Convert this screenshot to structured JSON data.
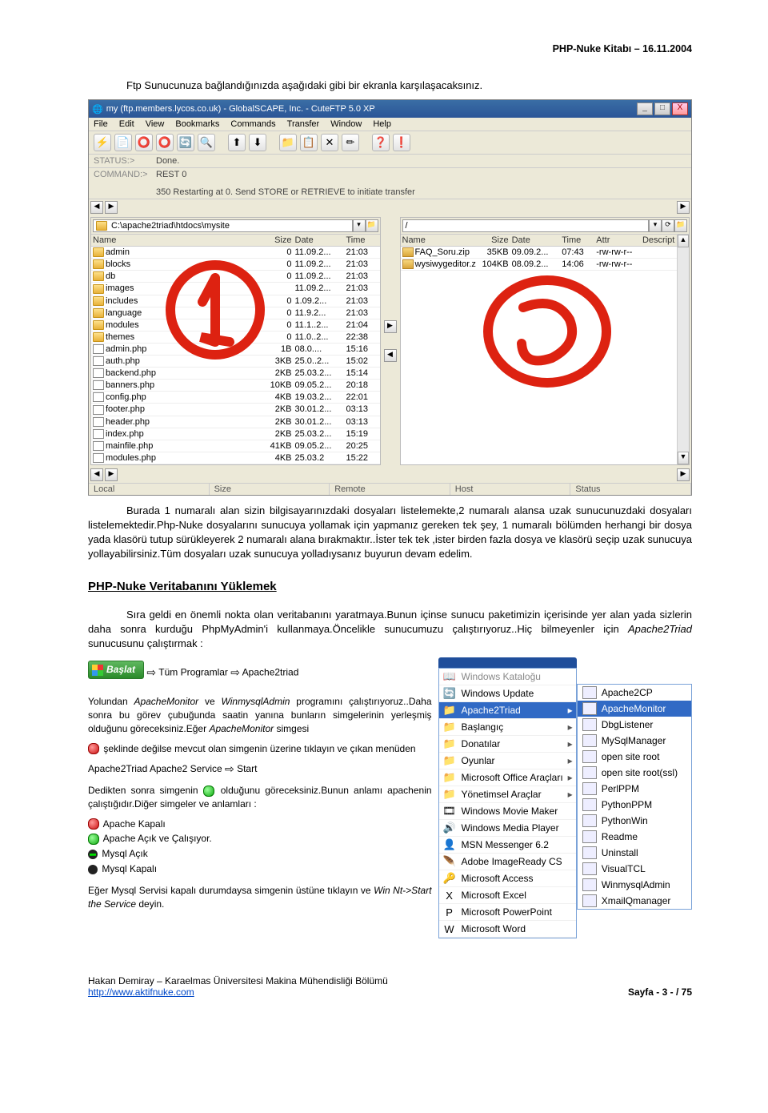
{
  "header": "PHP-Nuke Kitabı – 16.11.2004",
  "intro": "Ftp Sunucunuza bağlandığınızda aşağıdaki gibi bir ekranla karşılaşacaksınız.",
  "ftp": {
    "title": "my (ftp.members.lycos.co.uk) - GlobalSCAPE, Inc. - CuteFTP 5.0 XP",
    "menu": [
      "File",
      "Edit",
      "View",
      "Bookmarks",
      "Commands",
      "Transfer",
      "Window",
      "Help"
    ],
    "status": {
      "label": "STATUS:>",
      "value": "Done."
    },
    "command": {
      "label": "COMMAND:>",
      "value": "REST 0"
    },
    "command2": "350 Restarting at 0. Send STORE or RETRIEVE to initiate transfer",
    "left": {
      "path": "C:\\apache2triad\\htdocs\\mysite",
      "cols": [
        "Name",
        "Size",
        "Date",
        "Time"
      ],
      "rows": [
        {
          "t": "fold",
          "n": "admin",
          "s": "0",
          "d": "11.09.2...",
          "tm": "21:03"
        },
        {
          "t": "fold",
          "n": "blocks",
          "s": "0",
          "d": "11.09.2...",
          "tm": "21:03"
        },
        {
          "t": "fold",
          "n": "db",
          "s": "0",
          "d": "11.09.2...",
          "tm": "21:03"
        },
        {
          "t": "fold",
          "n": "images",
          "s": "",
          "d": "11.09.2...",
          "tm": "21:03"
        },
        {
          "t": "fold",
          "n": "includes",
          "s": "0",
          "d": "1.09.2...",
          "tm": "21:03"
        },
        {
          "t": "fold",
          "n": "language",
          "s": "0",
          "d": "11.9.2...",
          "tm": "21:03"
        },
        {
          "t": "fold",
          "n": "modules",
          "s": "0",
          "d": "11.1..2...",
          "tm": "21:04"
        },
        {
          "t": "fold",
          "n": "themes",
          "s": "0",
          "d": "11.0..2...",
          "tm": "22:38"
        },
        {
          "t": "file",
          "n": "admin.php",
          "s": "1B",
          "d": "08.0....",
          "tm": "15:16"
        },
        {
          "t": "file",
          "n": "auth.php",
          "s": "3KB",
          "d": "25.0..2...",
          "tm": "15:02"
        },
        {
          "t": "file",
          "n": "backend.php",
          "s": "2KB",
          "d": "25.03.2...",
          "tm": "15:14"
        },
        {
          "t": "file",
          "n": "banners.php",
          "s": "10KB",
          "d": "09.05.2...",
          "tm": "20:18"
        },
        {
          "t": "file",
          "n": "config.php",
          "s": "4KB",
          "d": "19.03.2...",
          "tm": "22:01"
        },
        {
          "t": "file",
          "n": "footer.php",
          "s": "2KB",
          "d": "30.01.2...",
          "tm": "03:13"
        },
        {
          "t": "file",
          "n": "header.php",
          "s": "2KB",
          "d": "30.01.2...",
          "tm": "03:13"
        },
        {
          "t": "file",
          "n": "index.php",
          "s": "2KB",
          "d": "25.03.2...",
          "tm": "15:19"
        },
        {
          "t": "file",
          "n": "mainfile.php",
          "s": "41KB",
          "d": "09.05.2...",
          "tm": "20:25"
        },
        {
          "t": "file",
          "n": "modules.php",
          "s": "4KB",
          "d": "25.03.2",
          "tm": "15:22"
        }
      ]
    },
    "right": {
      "path": "/",
      "cols": [
        "Name",
        "Size",
        "Date",
        "Time",
        "Attr",
        "Descript"
      ],
      "rows": [
        {
          "t": "zip",
          "n": "FAQ_Soru.zip",
          "s": "35KB",
          "d": "09.09.2...",
          "tm": "07:43",
          "a": "-rw-rw-r--"
        },
        {
          "t": "zip",
          "n": "wysiwygeditor.zip",
          "s": "104KB",
          "d": "08.09.2...",
          "tm": "14:06",
          "a": "-rw-rw-r--"
        }
      ]
    },
    "bottom": [
      "Local",
      "Size",
      "Remote",
      "Host",
      "Status"
    ]
  },
  "para2": "Burada 1 numaralı alan sizin bilgisayarınızdaki dosyaları listelemekte,2 numaralı alansa uzak sunucunuzdaki dosyaları listelemektedir.Php-Nuke dosyalarını sunucuya yollamak için yapmanız gereken tek şey, 1 numaralı bölümden herhangi bir dosya yada klasörü tutup sürükleyerek 2 numaralı alana bırakmaktır..İster tek tek ,ister birden fazla dosya ve klasörü seçip uzak sunucuya yollayabilirsiniz.Tüm dosyaları uzak sunucuya yolladıysanız buyurun devam edelim.",
  "h2": "PHP-Nuke Veritabanını Yüklemek",
  "para3a": "Sıra geldi en önemli nokta olan veritabanını yaratmaya.Bunun içinse sunucu paketimizin içerisinde yer alan yada sizlerin daha sonra kurduğu PhpMyAdmin'i kullanmaya.Öncelikle sunucumuzu çalıştırıyoruz..Hiç bilmeyenler için ",
  "para3b": "Apache2Triad",
  "para3c": " sunucusunu çalıştırmak :",
  "start": {
    "btn": "Başlat",
    "t1": "Tüm Programlar",
    "t2": "Apache2triad"
  },
  "lp1a": "Yolundan ",
  "lp1b": "ApacheMonitor",
  "lp1c": "  ve ",
  "lp1d": "WinmysqlAdmin",
  "lp1e": "  programını çalıştırıyoruz..Daha sonra bu görev çubuğunda saatin yanına bunların simgelerinin yerleşmiş olduğunu göreceksiniz.Eğer ",
  "lp1f": "ApacheMonitor",
  "lp1g": " simgesi",
  "lp2": "şeklinde değilse mevcut olan simgenin üzerine tıklayın ve çıkan menüden",
  "lp3a": "Apache2Triad Apache2 Service ",
  "lp3b": "Start",
  "lp4a": "Dedikten sonra simgenin ",
  "lp4b": " olduğunu göreceksiniz.Bunun  anlamı apachenin çalıştığıdır.Diğer simgeler ve anlamları :",
  "st": {
    "a": "Apache Kapalı",
    "b": "Apache Açık ve Çalışıyor.",
    "c": "Mysql Açık",
    "d": "Mysql Kapalı"
  },
  "lp5a": "Eğer Mysql Servisi kapalı durumdaysa simgenin üstüne tıklayın ve ",
  "lp5b": "Win Nt->Start the Service",
  "lp5c": " deyin.",
  "menu1": {
    "top": "Windows Kataloğu",
    "items": [
      {
        "ic": "🔄",
        "t": "Windows Update"
      },
      {
        "ic": "📁",
        "t": "Apache2Triad",
        "hl": true,
        "arr": true
      },
      {
        "ic": "📁",
        "t": "Başlangıç",
        "arr": true
      },
      {
        "ic": "📁",
        "t": "Donatılar",
        "arr": true
      },
      {
        "ic": "📁",
        "t": "Oyunlar",
        "arr": true
      },
      {
        "ic": "📁",
        "t": "Microsoft Office Araçları",
        "arr": true
      },
      {
        "ic": "📁",
        "t": "Yönetimsel Araçlar",
        "arr": true
      },
      {
        "ic": "🎞",
        "t": "Windows Movie Maker"
      },
      {
        "ic": "🔊",
        "t": "Windows Media Player"
      },
      {
        "ic": "👤",
        "t": "MSN Messenger 6.2"
      },
      {
        "ic": "🪶",
        "t": "Adobe ImageReady CS"
      },
      {
        "ic": "🔑",
        "t": "Microsoft Access"
      },
      {
        "ic": "X",
        "t": "Microsoft Excel"
      },
      {
        "ic": "P",
        "t": "Microsoft PowerPoint"
      },
      {
        "ic": "W",
        "t": "Microsoft Word"
      }
    ]
  },
  "menu2": [
    {
      "t": "Apache2CP"
    },
    {
      "t": "ApacheMonitor",
      "hl": true
    },
    {
      "t": "DbgListener"
    },
    {
      "t": "MySqlManager"
    },
    {
      "t": "open site root"
    },
    {
      "t": "open site root(ssl)"
    },
    {
      "t": "PerlPPM"
    },
    {
      "t": "PythonPPM"
    },
    {
      "t": "PythonWin"
    },
    {
      "t": "Readme"
    },
    {
      "t": "Uninstall"
    },
    {
      "t": "VisualTCL"
    },
    {
      "t": "WinmysqlAdmin"
    },
    {
      "t": "XmailQmanager"
    }
  ],
  "footer": {
    "l1": "Hakan Demiray – Karaelmas Üniversitesi Makina Mühendisliği Bölümü",
    "l2": "http://www.aktifnuke.com",
    "r": "Sayfa - 3 - / 75"
  }
}
